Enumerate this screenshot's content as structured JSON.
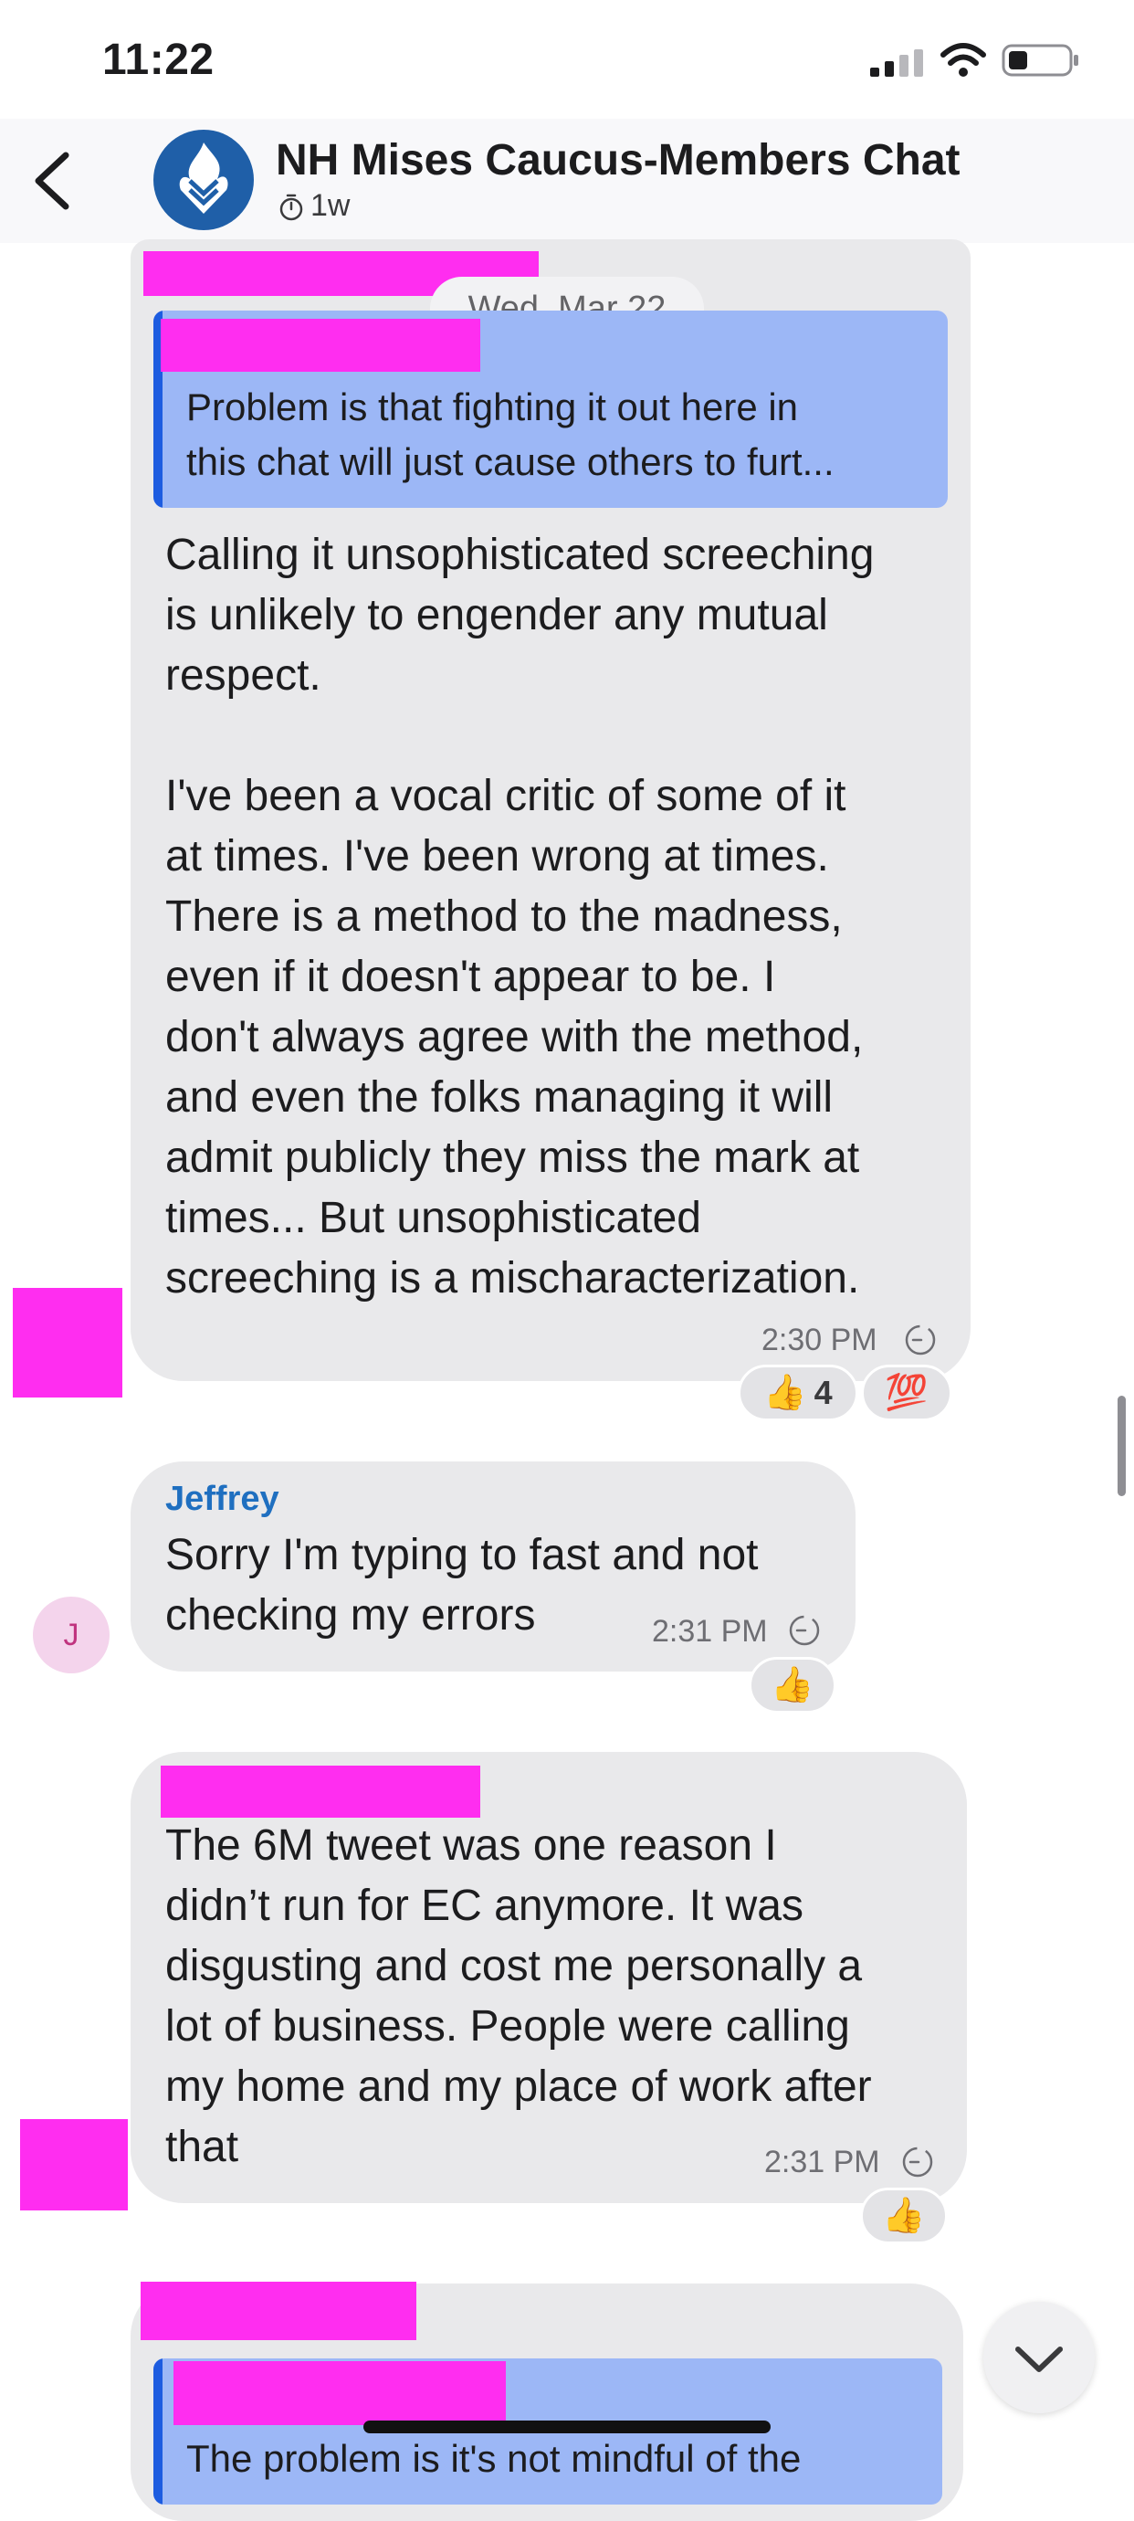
{
  "status_bar": {
    "time": "11:22"
  },
  "header": {
    "back_icon": "chevron-left-icon",
    "avatar_icon": "flame-logo-icon",
    "title": "NH Mises Caucus-Members Chat",
    "timer_icon": "timer-icon",
    "disappearing_timer": "1w"
  },
  "date_separator": "Wed, Mar 22",
  "messages": [
    {
      "reply_preview": "Problem is that fighting it out here in\nthis chat will just cause others to furt...",
      "text": "Calling it unsophisticated screeching\nis unlikely to engender any mutual\nrespect.\n\nI've been a vocal critic of some of it\nat times. I've been wrong at times.\nThere is a method to the madness,\neven if it doesn't appear to be. I\ndon't always agree with the method,\nand even the folks managing it will\nadmit publicly they miss the mark at\ntimes... But unsophisticated\nscreeching is a mischaracterization.",
      "time": "2:30 PM",
      "reactions": [
        {
          "emoji": "👍",
          "count": "4"
        },
        {
          "emoji": "💯",
          "count": ""
        }
      ]
    },
    {
      "sender": "Jeffrey",
      "avatar_initial": "J",
      "text": "Sorry I'm typing to fast and not\nchecking my errors",
      "time": "2:31 PM",
      "reactions": [
        {
          "emoji": "👍"
        }
      ]
    },
    {
      "text": "The 6M tweet was one reason I\ndidn’t run for EC anymore. It was\ndisgusting and cost me personally a\nlot of business. People were calling\nmy home and my place of work after\nthat",
      "time": "2:31 PM",
      "reactions": [
        {
          "emoji": "👍"
        }
      ]
    },
    {
      "reply_preview": "The problem is it's not mindful of the"
    }
  ]
}
